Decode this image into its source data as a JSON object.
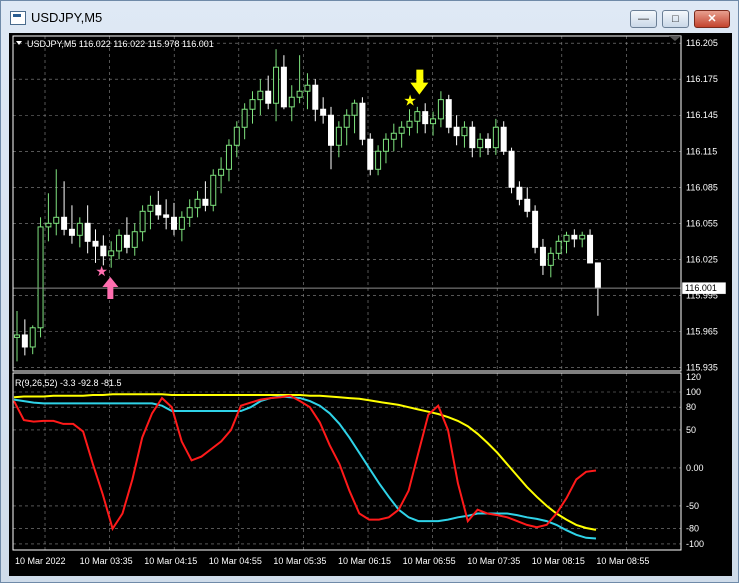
{
  "window": {
    "title": "USDJPY,M5",
    "icon": "chart-window-icon",
    "min_glyph": "—",
    "max_glyph": "□",
    "close_glyph": "✕"
  },
  "colors": {
    "background": "#000000",
    "grid": "#8a8a8a",
    "bull_candle": "#ffffff",
    "bear_candle": "#ffffff",
    "wick_up": "#7fe37f",
    "wick_down": "#ffffff",
    "price_line": "#8c8c8c",
    "sell_arrow": "#ffff00",
    "buy_arrow": "#ff6fb0",
    "line_fast": "#ff1a1a",
    "line_mid": "#2fd3e8",
    "line_slow": "#ffff00"
  },
  "main_chart": {
    "info": "USDJPY,M5  116.022 116.022 115.978 116.001",
    "y_labels": [
      "116.205",
      "116.175",
      "116.145",
      "116.115",
      "116.085",
      "116.055",
      "116.025",
      "115.995",
      "115.965",
      "115.935"
    ],
    "current_price": "116.001"
  },
  "indicator": {
    "info": "R(9,26,52) -3.3 -92.8 -81.5",
    "y_labels": [
      "120",
      "100",
      "80",
      "50",
      "0.00",
      "-50",
      "-80",
      "-100"
    ]
  },
  "time_labels": [
    "10 Mar 2022",
    "10 Mar 03:35",
    "10 Mar 04:15",
    "10 Mar 04:55",
    "10 Mar 05:35",
    "10 Mar 06:15",
    "10 Mar 06:55",
    "10 Mar 07:35",
    "10 Mar 08:15",
    "10 Mar 08:55"
  ],
  "chart_data": {
    "type": "candlestick",
    "symbol": "USDJPY",
    "timeframe": "M5",
    "price_range": [
      115.932,
      116.211
    ],
    "candles": [
      [
        115.96,
        115.982,
        115.94,
        115.962
      ],
      [
        115.962,
        115.975,
        115.945,
        115.952
      ],
      [
        115.952,
        115.97,
        115.946,
        115.968
      ],
      [
        115.968,
        116.06,
        115.96,
        116.052
      ],
      [
        116.052,
        116.08,
        116.04,
        116.055
      ],
      [
        116.055,
        116.1,
        116.045,
        116.06
      ],
      [
        116.06,
        116.09,
        116.045,
        116.05
      ],
      [
        116.05,
        116.07,
        116.038,
        116.045
      ],
      [
        116.045,
        116.06,
        116.035,
        116.055
      ],
      [
        116.055,
        116.07,
        116.03,
        116.04
      ],
      [
        116.04,
        116.05,
        116.022,
        116.036
      ],
      [
        116.036,
        116.045,
        116.02,
        116.028
      ],
      [
        116.028,
        116.04,
        116.018,
        116.032
      ],
      [
        116.032,
        116.05,
        116.025,
        116.045
      ],
      [
        116.045,
        116.06,
        116.03,
        116.035
      ],
      [
        116.035,
        116.055,
        116.028,
        116.048
      ],
      [
        116.048,
        116.07,
        116.04,
        116.065
      ],
      [
        116.065,
        116.078,
        116.05,
        116.07
      ],
      [
        116.07,
        116.082,
        116.058,
        116.062
      ],
      [
        116.062,
        116.075,
        116.05,
        116.06
      ],
      [
        116.06,
        116.072,
        116.045,
        116.05
      ],
      [
        116.05,
        116.065,
        116.04,
        116.06
      ],
      [
        116.06,
        116.075,
        116.052,
        116.068
      ],
      [
        116.068,
        116.082,
        116.06,
        116.075
      ],
      [
        116.075,
        116.09,
        116.065,
        116.07
      ],
      [
        116.07,
        116.1,
        116.065,
        116.095
      ],
      [
        116.095,
        116.11,
        116.08,
        116.1
      ],
      [
        116.1,
        116.125,
        116.09,
        116.12
      ],
      [
        116.12,
        116.14,
        116.11,
        116.135
      ],
      [
        116.135,
        116.155,
        116.125,
        116.15
      ],
      [
        116.15,
        116.165,
        116.138,
        116.158
      ],
      [
        116.158,
        116.175,
        116.145,
        116.165
      ],
      [
        116.165,
        116.178,
        116.15,
        116.155
      ],
      [
        116.155,
        116.2,
        116.14,
        116.185
      ],
      [
        116.185,
        116.195,
        116.15,
        116.152
      ],
      [
        116.152,
        116.17,
        116.14,
        116.16
      ],
      [
        116.16,
        116.195,
        116.155,
        116.165
      ],
      [
        116.165,
        116.18,
        116.15,
        116.17
      ],
      [
        116.17,
        116.175,
        116.14,
        116.15
      ],
      [
        116.15,
        116.16,
        116.138,
        116.145
      ],
      [
        116.145,
        116.152,
        116.1,
        116.12
      ],
      [
        116.12,
        116.14,
        116.11,
        116.135
      ],
      [
        116.135,
        116.15,
        116.12,
        116.145
      ],
      [
        116.145,
        116.158,
        116.13,
        116.155
      ],
      [
        116.155,
        116.16,
        116.12,
        116.125
      ],
      [
        116.125,
        116.13,
        116.095,
        116.1
      ],
      [
        116.1,
        116.12,
        116.095,
        116.115
      ],
      [
        116.115,
        116.13,
        116.105,
        116.125
      ],
      [
        116.125,
        116.138,
        116.115,
        116.13
      ],
      [
        116.13,
        116.14,
        116.118,
        116.135
      ],
      [
        116.135,
        116.15,
        116.128,
        116.14
      ],
      [
        116.14,
        116.152,
        116.13,
        116.148
      ],
      [
        116.148,
        116.155,
        116.13,
        116.138
      ],
      [
        116.138,
        116.148,
        116.128,
        116.142
      ],
      [
        116.142,
        116.165,
        116.135,
        116.158
      ],
      [
        116.158,
        116.162,
        116.13,
        116.135
      ],
      [
        116.135,
        116.145,
        116.12,
        116.128
      ],
      [
        116.128,
        116.14,
        116.118,
        116.135
      ],
      [
        116.135,
        116.14,
        116.11,
        116.118
      ],
      [
        116.118,
        116.13,
        116.11,
        116.125
      ],
      [
        116.125,
        116.13,
        116.112,
        116.118
      ],
      [
        116.118,
        116.142,
        116.112,
        116.135
      ],
      [
        116.135,
        116.14,
        116.112,
        116.115
      ],
      [
        116.115,
        116.118,
        116.08,
        116.085
      ],
      [
        116.085,
        116.09,
        116.07,
        116.075
      ],
      [
        116.075,
        116.085,
        116.06,
        116.065
      ],
      [
        116.065,
        116.07,
        116.03,
        116.035
      ],
      [
        116.035,
        116.042,
        116.012,
        116.02
      ],
      [
        116.02,
        116.035,
        116.01,
        116.03
      ],
      [
        116.03,
        116.045,
        116.025,
        116.04
      ],
      [
        116.04,
        116.048,
        116.03,
        116.045
      ],
      [
        116.045,
        116.05,
        116.035,
        116.042
      ],
      [
        116.042,
        116.048,
        116.035,
        116.045
      ],
      [
        116.045,
        116.05,
        116.03,
        116.022
      ],
      [
        116.022,
        116.022,
        115.978,
        116.001
      ]
    ],
    "signals": [
      {
        "type": "buy",
        "candle": 11,
        "price": 116.012
      },
      {
        "type": "sell",
        "candle": 51,
        "price": 116.158
      }
    ],
    "indicator": {
      "name": "R(9,26,52)",
      "range": [
        -108,
        125
      ],
      "series": [
        {
          "name": "R9",
          "color": "#ff1a1a",
          "values": [
            88,
            63,
            61,
            62,
            62,
            58,
            58,
            48,
            5,
            -35,
            -80,
            -60,
            -15,
            40,
            72,
            92,
            80,
            35,
            10,
            15,
            25,
            35,
            50,
            82,
            86,
            90,
            92,
            93,
            95,
            88,
            80,
            60,
            30,
            5,
            -30,
            -60,
            -68,
            -68,
            -65,
            -55,
            -30,
            20,
            70,
            82,
            50,
            -20,
            -70,
            -55,
            -60,
            -62,
            -65,
            -70,
            -75,
            -78,
            -75,
            -60,
            -40,
            -15,
            -5,
            -3.3
          ]
        },
        {
          "name": "R26",
          "color": "#2fd3e8",
          "values": [
            90,
            88,
            86,
            85,
            85,
            85,
            85,
            85,
            85,
            85,
            85,
            85,
            85,
            85,
            85,
            82,
            75,
            75,
            75,
            75,
            75,
            75,
            75,
            75,
            80,
            88,
            92,
            94,
            93,
            92,
            88,
            82,
            72,
            58,
            40,
            20,
            0,
            -20,
            -38,
            -55,
            -65,
            -70,
            -70,
            -70,
            -68,
            -65,
            -63,
            -60,
            -60,
            -60,
            -60,
            -62,
            -65,
            -67,
            -70,
            -75,
            -82,
            -88,
            -92,
            -92.8
          ]
        },
        {
          "name": "R52",
          "color": "#ffff00",
          "values": [
            93,
            94,
            94,
            94,
            95,
            95,
            95,
            95,
            96,
            96,
            97,
            97,
            97,
            97,
            97,
            97,
            96,
            96,
            96,
            96,
            96,
            96,
            96,
            96,
            96,
            96,
            96,
            96,
            96,
            96,
            95,
            95,
            94,
            93,
            92,
            91,
            89,
            87,
            85,
            83,
            80,
            77,
            74,
            71,
            67,
            62,
            55,
            45,
            33,
            20,
            5,
            -10,
            -25,
            -38,
            -50,
            -60,
            -68,
            -75,
            -79,
            -81.5
          ]
        }
      ]
    }
  }
}
